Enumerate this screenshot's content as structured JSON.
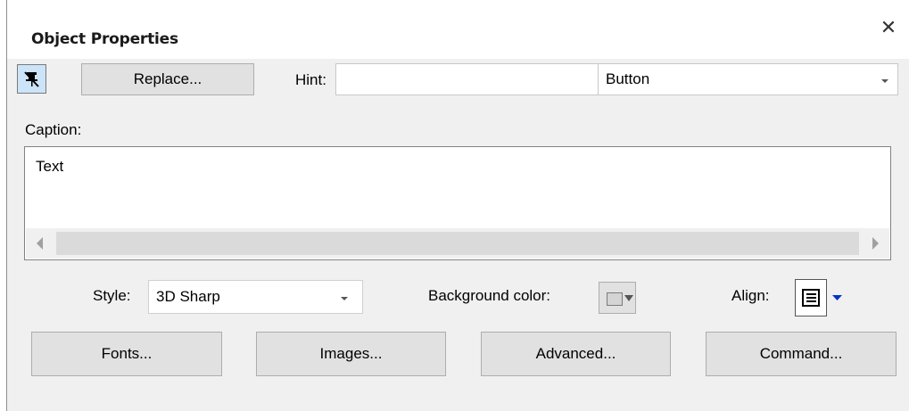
{
  "dialog": {
    "title": "Object Properties",
    "close_glyph": "✕"
  },
  "toolbar": {
    "pin_icon": "pin-icon",
    "replace_label": "Replace...",
    "hint_label": "Hint:",
    "hint_value": "",
    "type_value": "Button"
  },
  "caption": {
    "label": "Caption:",
    "value": "Text"
  },
  "style": {
    "label": "Style:",
    "value": "3D Sharp"
  },
  "background": {
    "label": "Background color:",
    "swatch_color": "#d4d4d4"
  },
  "align": {
    "label": "Align:",
    "icon": "align-left-icon"
  },
  "buttons": {
    "fonts": "Fonts...",
    "images": "Images...",
    "advanced": "Advanced...",
    "command": "Command..."
  },
  "colors": {
    "window_bg": "#f0f0f0",
    "button_bg": "#e1e1e1",
    "pin_bg": "#cce4f7",
    "dropdown_arrow_accent": "#0033cc"
  }
}
